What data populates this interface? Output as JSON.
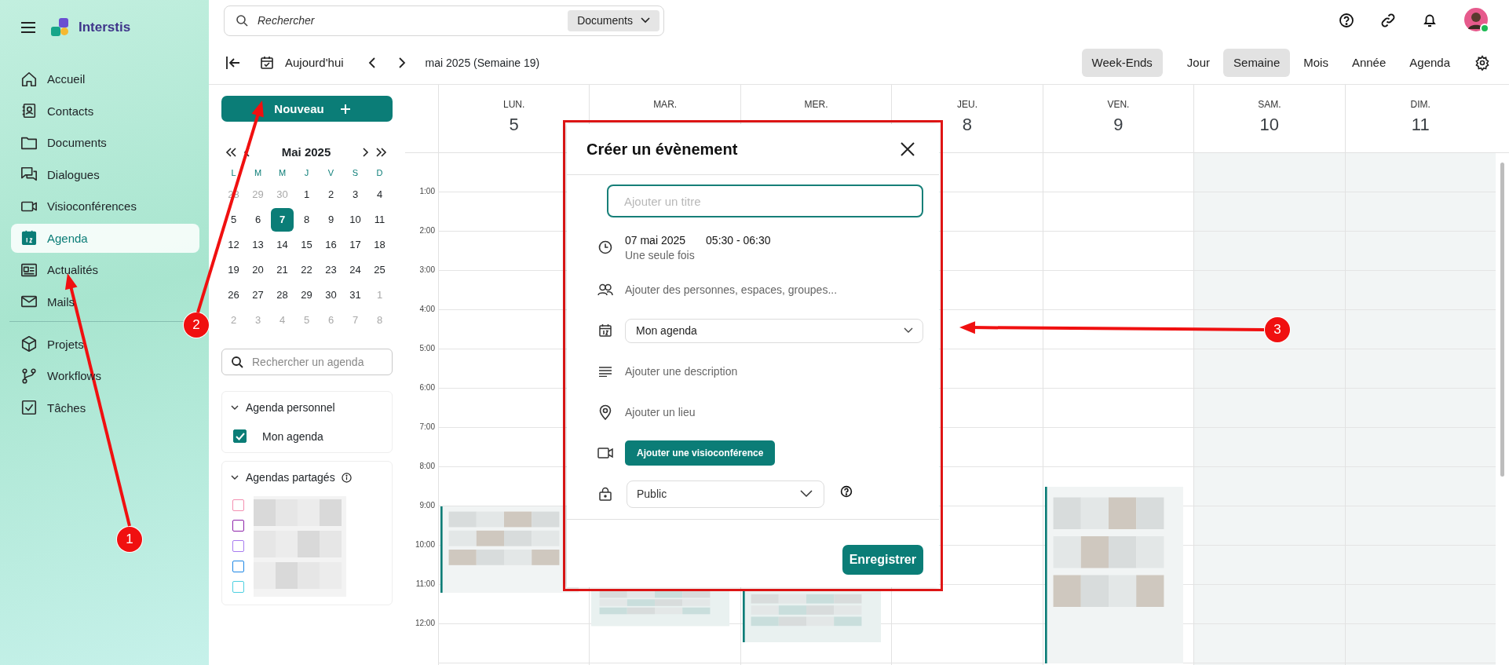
{
  "app": {
    "name": "Interstis"
  },
  "nav": {
    "groups": [
      [
        {
          "label": "Accueil",
          "selected": false
        },
        {
          "label": "Contacts",
          "selected": false
        },
        {
          "label": "Documents",
          "selected": false
        },
        {
          "label": "Dialogues",
          "selected": false
        },
        {
          "label": "Visioconférences",
          "selected": false
        },
        {
          "label": "Agenda",
          "selected": true
        },
        {
          "label": "Actualités",
          "selected": false
        },
        {
          "label": "Mails",
          "selected": false
        }
      ],
      [
        {
          "label": "Projets",
          "selected": false
        },
        {
          "label": "Workflows",
          "selected": false
        },
        {
          "label": "Tâches",
          "selected": false
        }
      ]
    ]
  },
  "search": {
    "placeholder": "Rechercher",
    "scope": "Documents"
  },
  "toolbar": {
    "today": "Aujourd'hui",
    "period": "mai 2025 (Semaine 19)",
    "weekends": {
      "label": "Week-Ends",
      "on": true
    },
    "views": [
      {
        "label": "Jour",
        "selected": false
      },
      {
        "label": "Semaine",
        "selected": true
      },
      {
        "label": "Mois",
        "selected": false
      },
      {
        "label": "Année",
        "selected": false
      },
      {
        "label": "Agenda",
        "selected": false
      }
    ]
  },
  "new_button": "Nouveau",
  "mini_calendar": {
    "title": "Mai 2025",
    "weekdays": [
      "L",
      "M",
      "M",
      "J",
      "V",
      "S",
      "D"
    ],
    "weeks": [
      [
        {
          "label": "28",
          "muted": true,
          "selected": false
        },
        {
          "label": "29",
          "muted": true,
          "selected": false
        },
        {
          "label": "30",
          "muted": true,
          "selected": false
        },
        {
          "label": "1",
          "muted": false,
          "selected": false
        },
        {
          "label": "2",
          "muted": false,
          "selected": false
        },
        {
          "label": "3",
          "muted": false,
          "selected": false
        },
        {
          "label": "4",
          "muted": false,
          "selected": false
        }
      ],
      [
        {
          "label": "5",
          "muted": false,
          "selected": false
        },
        {
          "label": "6",
          "muted": false,
          "selected": false
        },
        {
          "label": "7",
          "muted": false,
          "selected": true
        },
        {
          "label": "8",
          "muted": false,
          "selected": false
        },
        {
          "label": "9",
          "muted": false,
          "selected": false
        },
        {
          "label": "10",
          "muted": false,
          "selected": false
        },
        {
          "label": "11",
          "muted": false,
          "selected": false
        }
      ],
      [
        {
          "label": "12",
          "muted": false,
          "selected": false
        },
        {
          "label": "13",
          "muted": false,
          "selected": false
        },
        {
          "label": "14",
          "muted": false,
          "selected": false
        },
        {
          "label": "15",
          "muted": false,
          "selected": false
        },
        {
          "label": "16",
          "muted": false,
          "selected": false
        },
        {
          "label": "17",
          "muted": false,
          "selected": false
        },
        {
          "label": "18",
          "muted": false,
          "selected": false
        }
      ],
      [
        {
          "label": "19",
          "muted": false,
          "selected": false
        },
        {
          "label": "20",
          "muted": false,
          "selected": false
        },
        {
          "label": "21",
          "muted": false,
          "selected": false
        },
        {
          "label": "22",
          "muted": false,
          "selected": false
        },
        {
          "label": "23",
          "muted": false,
          "selected": false
        },
        {
          "label": "24",
          "muted": false,
          "selected": false
        },
        {
          "label": "25",
          "muted": false,
          "selected": false
        }
      ],
      [
        {
          "label": "26",
          "muted": false,
          "selected": false
        },
        {
          "label": "27",
          "muted": false,
          "selected": false
        },
        {
          "label": "28",
          "muted": false,
          "selected": false
        },
        {
          "label": "29",
          "muted": false,
          "selected": false
        },
        {
          "label": "30",
          "muted": false,
          "selected": false
        },
        {
          "label": "31",
          "muted": false,
          "selected": false
        },
        {
          "label": "1",
          "muted": true,
          "selected": false
        }
      ],
      [
        {
          "label": "2",
          "muted": true,
          "selected": false
        },
        {
          "label": "3",
          "muted": true,
          "selected": false
        },
        {
          "label": "4",
          "muted": true,
          "selected": false
        },
        {
          "label": "5",
          "muted": true,
          "selected": false
        },
        {
          "label": "6",
          "muted": true,
          "selected": false
        },
        {
          "label": "7",
          "muted": true,
          "selected": false
        },
        {
          "label": "8",
          "muted": true,
          "selected": false
        }
      ]
    ]
  },
  "agenda_search": {
    "placeholder": "Rechercher un agenda"
  },
  "personal": {
    "title": "Agenda personnel",
    "expanded": true,
    "items": [
      {
        "label": "Mon agenda",
        "checked": true
      }
    ]
  },
  "shared": {
    "title": "Agendas partagés",
    "expanded": true,
    "items": [
      {
        "color": "#f48fb1",
        "checked": false
      },
      {
        "color": "#8e24aa",
        "checked": false
      },
      {
        "color": "#a87cf0",
        "checked": false
      },
      {
        "color": "#1e88e5",
        "checked": false
      },
      {
        "color": "#4dd0e1",
        "checked": false
      }
    ]
  },
  "week": {
    "days": [
      {
        "label": "LUN.",
        "number": "5",
        "weekend": false
      },
      {
        "label": "MAR.",
        "weekend": false
      },
      {
        "label": "MER.",
        "weekend": false
      },
      {
        "label": "JEU.",
        "number": "8",
        "weekend": false
      },
      {
        "label": "VEN.",
        "number": "9",
        "weekend": false
      },
      {
        "label": "SAM.",
        "number": "10",
        "weekend": true
      },
      {
        "label": "DIM.",
        "number": "11",
        "weekend": true
      }
    ],
    "hours": [
      "1:00",
      "2:00",
      "3:00",
      "4:00",
      "5:00",
      "6:00",
      "7:00",
      "8:00",
      "9:00",
      "10:00",
      "11:00",
      "12:00"
    ]
  },
  "dialog": {
    "title": "Créer un évènement",
    "title_field": {
      "placeholder": "Ajouter un titre"
    },
    "date": "07 mai 2025",
    "time": "05:30 - 06:30",
    "recurrence": "Une seule fois",
    "people": {
      "placeholder": "Ajouter des personnes, espaces, groupes..."
    },
    "agenda_select": {
      "value": "Mon agenda"
    },
    "description": {
      "placeholder": "Ajouter une description"
    },
    "location": {
      "placeholder": "Ajouter un lieu"
    },
    "visio_button": "Ajouter une visioconférence",
    "visibility_select": {
      "value": "Public"
    },
    "save_button": "Enregistrer"
  },
  "annotations": [
    {
      "label": "1"
    },
    {
      "label": "2"
    },
    {
      "label": "3"
    }
  ]
}
